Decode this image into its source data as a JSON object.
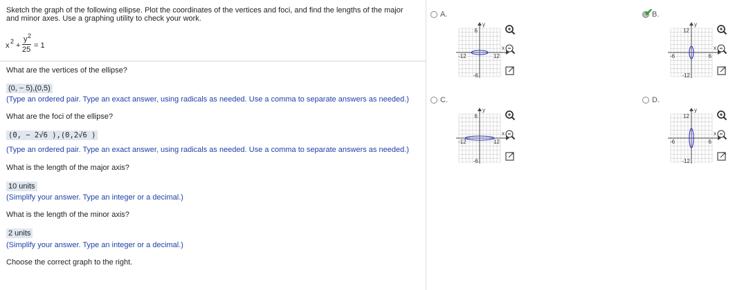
{
  "problem": {
    "line1": "Sketch the graph of the following ellipse. Plot the coordinates of the vertices and foci, and find the lengths of the major",
    "line2": "and minor axes. Use a graphing utility to check your work.",
    "equation": {
      "x_term": "x",
      "x_exp": "2",
      "plus": "+",
      "y_num": "y",
      "y_exp": "2",
      "y_den": "25",
      "eq": "= 1"
    }
  },
  "questions": [
    {
      "prompt": "What are the vertices of the ellipse?",
      "answer": "(0, − 5),(0,5)",
      "hint": "(Type an ordered pair.  Type an exact answer, using radicals as needed. Use a comma to separate answers as needed.)"
    },
    {
      "prompt": "What are the foci of the ellipse?",
      "answer": "(0, − 2√6 ),(0,2√6 )",
      "hint": "(Type an ordered pair.  Type an exact answer, using radicals as needed. Use a comma to separate answers as needed.)"
    },
    {
      "prompt": "What is the length of the major axis?",
      "answer": "10 units",
      "hint": "(Simplify your answer. Type an integer or a decimal.)"
    },
    {
      "prompt": "What is the length of the minor axis?",
      "answer": "2 units",
      "hint": "(Simplify your answer. Type an integer or a decimal.)"
    }
  ],
  "instruction": "Choose the correct graph to the right.",
  "options": [
    {
      "letter": "A.",
      "selected": false,
      "orientation": "horizontal",
      "ticks": {
        "top": "6",
        "bottom": "-6",
        "left": "-12",
        "right": "12"
      },
      "axis_x": "x",
      "axis_y": "y"
    },
    {
      "letter": "B.",
      "selected": true,
      "orientation": "vertical",
      "ticks": {
        "top": "12",
        "bottom": "-12",
        "left": "-6",
        "right": "6"
      },
      "axis_x": "x",
      "axis_y": "y"
    },
    {
      "letter": "C.",
      "selected": false,
      "orientation": "horizontal",
      "ticks": {
        "top": "6",
        "bottom": "-6",
        "left": "-12",
        "right": "12"
      },
      "axis_x": "x",
      "axis_y": "y"
    },
    {
      "letter": "D.",
      "selected": false,
      "orientation": "vertical",
      "ticks": {
        "top": "12",
        "bottom": "-12",
        "left": "-6",
        "right": "6"
      },
      "axis_x": "x",
      "axis_y": "y"
    }
  ],
  "colors": {
    "ellipse": "#2a2ad6",
    "hint": "#1f3fa8",
    "answer_bg": "#dfe6ef",
    "check": "#2aa32a",
    "grid": "#c8c8c8"
  }
}
